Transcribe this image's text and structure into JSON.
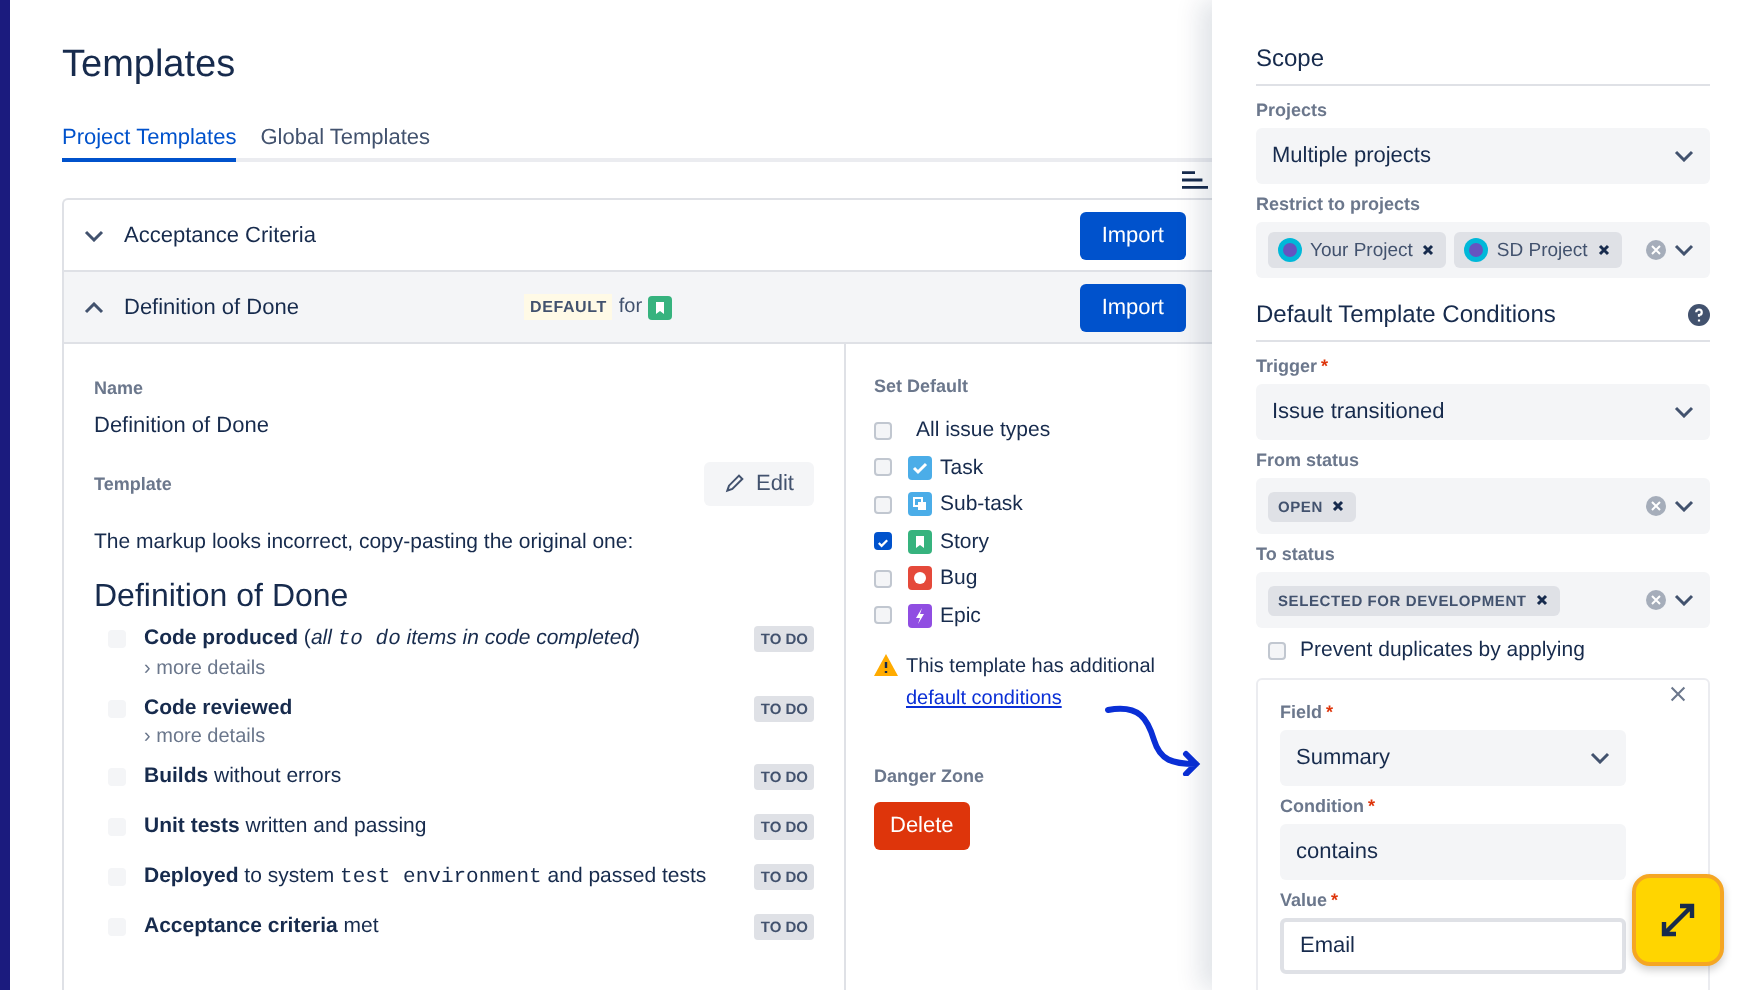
{
  "title": "Templates",
  "tabs": [
    {
      "label": "Project Templates",
      "selected": true
    },
    {
      "label": "Global Templates",
      "selected": false
    }
  ],
  "templates": [
    {
      "name": "Acceptance Criteria",
      "expanded": false,
      "button": "Import"
    },
    {
      "name": "Definition of Done",
      "expanded": true,
      "default_badge": "DEFAULT",
      "default_for": "for",
      "button": "Import"
    }
  ],
  "detail": {
    "name_label": "Name",
    "name_value": "Definition of Done",
    "template_label": "Template",
    "edit_button": "Edit",
    "intro": "The markup looks incorrect, copy-pasting the original one:",
    "heading": "Definition of Done",
    "items": [
      {
        "checked": false,
        "segments": [
          {
            "kind": "bold",
            "text": "Code produced"
          },
          {
            "kind": "plain",
            "text": " ("
          },
          {
            "kind": "italic",
            "text": "all "
          },
          {
            "kind": "italic-code",
            "text": "to do"
          },
          {
            "kind": "italic",
            "text": " items in code completed"
          },
          {
            "kind": "plain",
            "text": ")"
          }
        ],
        "details": "› more details",
        "status": "TO DO"
      },
      {
        "checked": false,
        "segments": [
          {
            "kind": "bold",
            "text": "Code reviewed"
          }
        ],
        "details": "› more details",
        "status": "TO DO"
      },
      {
        "checked": false,
        "segments": [
          {
            "kind": "bold",
            "text": "Builds"
          },
          {
            "kind": "plain",
            "text": " without errors"
          }
        ],
        "status": "TO DO"
      },
      {
        "checked": false,
        "segments": [
          {
            "kind": "bold",
            "text": "Unit tests"
          },
          {
            "kind": "plain",
            "text": " written and passing"
          }
        ],
        "status": "TO DO"
      },
      {
        "checked": false,
        "segments": [
          {
            "kind": "bold",
            "text": "Deployed"
          },
          {
            "kind": "plain",
            "text": " to system "
          },
          {
            "kind": "code",
            "text": "test environment"
          },
          {
            "kind": "plain",
            "text": " and passed tests"
          }
        ],
        "status": "TO DO"
      },
      {
        "checked": false,
        "segments": [
          {
            "kind": "bold",
            "text": "Acceptance criteria"
          },
          {
            "kind": "plain",
            "text": " met"
          }
        ],
        "status": "TO DO"
      }
    ]
  },
  "set_default": {
    "label": "Set Default",
    "options": [
      {
        "label": "All issue types",
        "checked": false,
        "kind": "all"
      },
      {
        "label": "Task",
        "checked": false,
        "kind": "task"
      },
      {
        "label": "Sub-task",
        "checked": false,
        "kind": "subtask"
      },
      {
        "label": "Story",
        "checked": true,
        "kind": "story"
      },
      {
        "label": "Bug",
        "checked": false,
        "kind": "bug"
      },
      {
        "label": "Epic",
        "checked": false,
        "kind": "epic"
      }
    ],
    "warning": "This template has additional",
    "warning_link": "default conditions"
  },
  "danger": {
    "label": "Danger Zone",
    "button": "Delete"
  },
  "panel": {
    "scope_heading": "Scope",
    "scope_fields": [
      {
        "kind": "select",
        "label": "Projects",
        "value": "Multiple projects"
      },
      {
        "kind": "multi",
        "label": "Restrict to projects",
        "tags": [
          {
            "text": "Your Project",
            "kind": "project"
          },
          {
            "text": "SD Project",
            "kind": "project"
          }
        ]
      }
    ],
    "conditions_heading": "Default Template Conditions",
    "condition_fields": [
      {
        "kind": "select",
        "label": "Trigger",
        "required_mark": "*",
        "value": "Issue transitioned"
      },
      {
        "kind": "multi",
        "label": "From status",
        "tags": [
          {
            "text": "OPEN",
            "kind": "status"
          }
        ]
      },
      {
        "kind": "multi",
        "label": "To status",
        "tags": [
          {
            "text": "SELECTED FOR DEVELOPMENT",
            "kind": "status"
          }
        ]
      }
    ],
    "prevent": {
      "label": "Prevent duplicates by applying",
      "checked": false
    },
    "card_fields": [
      {
        "kind": "select",
        "label": "Field",
        "required_mark": "*",
        "value": "Summary"
      },
      {
        "kind": "text",
        "label": "Condition",
        "required_mark": "*",
        "value": "contains"
      },
      {
        "kind": "input",
        "label": "Value",
        "required_mark": "*",
        "value": "Email"
      }
    ]
  }
}
